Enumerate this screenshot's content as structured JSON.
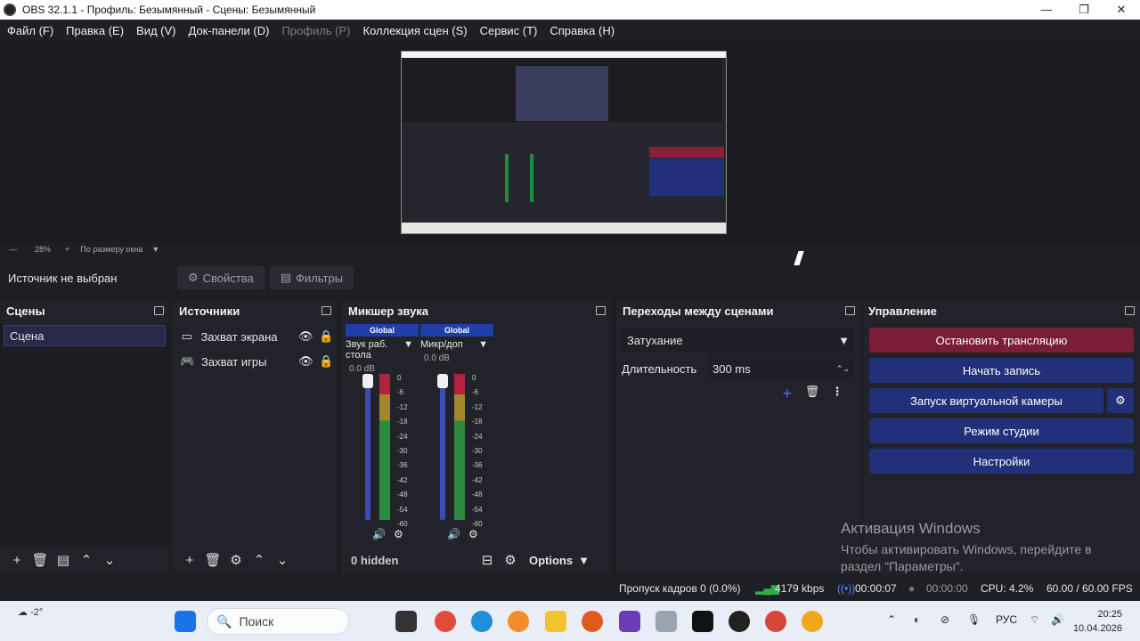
{
  "window": {
    "title": "OBS 32.1.1 - Профиль: Безымянный - Сцены: Безымянный",
    "controls": [
      "—",
      "❐",
      "✕"
    ]
  },
  "menu": [
    {
      "label": "Файл (F)",
      "disabled": false
    },
    {
      "label": "Правка (E)",
      "disabled": false
    },
    {
      "label": "Вид (V)",
      "disabled": false
    },
    {
      "label": "Док-панели (D)",
      "disabled": false
    },
    {
      "label": "Профиль (P)",
      "disabled": true
    },
    {
      "label": "Коллекция сцен (S)",
      "disabled": false
    },
    {
      "label": "Сервис (T)",
      "disabled": false
    },
    {
      "label": "Справка (H)",
      "disabled": false
    }
  ],
  "zoom": {
    "minus": "—",
    "value": "28%",
    "plus": "+",
    "mode": "По размеру окна"
  },
  "source_bar": {
    "no_source": "Источник не выбран",
    "properties": "Свойства",
    "filters": "Фильтры"
  },
  "scenes": {
    "title": "Сцены",
    "items": [
      "Сцена"
    ]
  },
  "sources": {
    "title": "Источники",
    "items": [
      {
        "label": "Захват экрана",
        "icon": "monitor-icon"
      },
      {
        "label": "Захват игры",
        "icon": "gamepad-icon"
      }
    ]
  },
  "mixer": {
    "title": "Микшер звука",
    "channels": [
      {
        "badge": "Global",
        "name": "Звук раб. стола",
        "db": "0.0 dB"
      },
      {
        "badge": "Global",
        "name": "Микр/доп",
        "db": "0.0 dB"
      }
    ],
    "scale": [
      "0",
      "-6",
      "-12",
      "-18",
      "-24",
      "-30",
      "-36",
      "-42",
      "-48",
      "-54",
      "-60"
    ],
    "hidden": "0 hidden",
    "options": "Options"
  },
  "transitions": {
    "title": "Переходы между сценами",
    "selected": "Затухание",
    "duration_label": "Длительность",
    "duration_value": "300 ms"
  },
  "controls": {
    "title": "Управление",
    "stop_stream": "Остановить трансляцию",
    "start_record": "Начать запись",
    "virtual_cam": "Запуск виртуальной камеры",
    "studio_mode": "Режим студии",
    "settings": "Настройки"
  },
  "status": {
    "dropped": "Пропуск кадров 0 (0.0%)",
    "bitrate": "4179 kbps",
    "stream_time": "00:00:07",
    "rec_time": "00:00:00",
    "cpu": "CPU: 4.2%",
    "fps": "60.00 / 60.00 FPS"
  },
  "watermark": {
    "title": "Активация Windows",
    "line1": "Чтобы активировать Windows, перейдите в",
    "line2": "раздел \"Параметры\"."
  },
  "taskbar": {
    "weather": "-2°",
    "search": "Поиск",
    "lang": "РУС",
    "time": "20:25",
    "date": "10.04.2026"
  },
  "colors": {
    "accent_blue": "#22307a",
    "stop_red": "#7a1d37",
    "panel_bg": "#22222a"
  }
}
